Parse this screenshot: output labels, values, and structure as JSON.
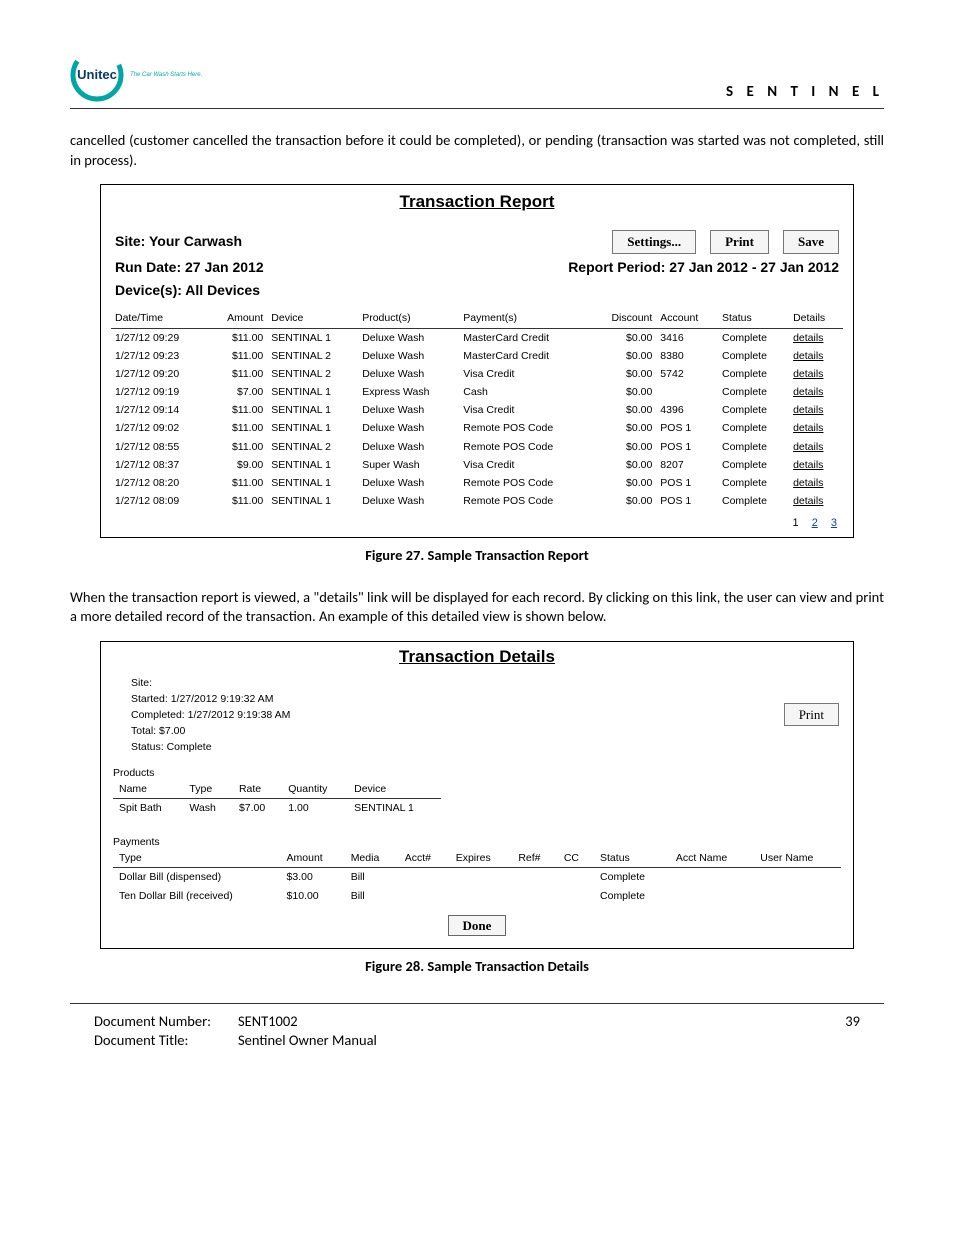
{
  "header": {
    "brand": "Unitec",
    "tagline": "The Car Wash Starts Here.",
    "product": "S E N T I N E L"
  },
  "para1": "cancelled (customer cancelled the transaction before it could be completed), or pending (transaction was started was not completed, still in process).",
  "report1": {
    "title": "Transaction Report",
    "site_label": "Site: Your Carwash",
    "btn_settings": "Settings...",
    "btn_print": "Print",
    "btn_save": "Save",
    "run_date": "Run Date: 27 Jan 2012",
    "period": "Report Period: 27 Jan 2012 - 27 Jan 2012",
    "devices": "Device(s): All Devices",
    "columns": [
      "Date/Time",
      "Amount",
      "Device",
      "Product(s)",
      "Payment(s)",
      "Discount",
      "Account",
      "Status",
      "Details"
    ],
    "details_label": "details",
    "rows": [
      {
        "dt": "1/27/12 09:29",
        "amt": "$11.00",
        "dev": "SENTINAL 1",
        "prod": "Deluxe Wash",
        "pay": "MasterCard Credit",
        "disc": "$0.00",
        "acct": "3416",
        "stat": "Complete"
      },
      {
        "dt": "1/27/12 09:23",
        "amt": "$11.00",
        "dev": "SENTINAL 2",
        "prod": "Deluxe Wash",
        "pay": "MasterCard Credit",
        "disc": "$0.00",
        "acct": "8380",
        "stat": "Complete"
      },
      {
        "dt": "1/27/12 09:20",
        "amt": "$11.00",
        "dev": "SENTINAL 2",
        "prod": "Deluxe Wash",
        "pay": "Visa Credit",
        "disc": "$0.00",
        "acct": "5742",
        "stat": "Complete"
      },
      {
        "dt": "1/27/12 09:19",
        "amt": "$7.00",
        "dev": "SENTINAL 1",
        "prod": "Express Wash",
        "pay": "Cash",
        "disc": "$0.00",
        "acct": "",
        "stat": "Complete"
      },
      {
        "dt": "1/27/12 09:14",
        "amt": "$11.00",
        "dev": "SENTINAL 1",
        "prod": "Deluxe Wash",
        "pay": "Visa Credit",
        "disc": "$0.00",
        "acct": "4396",
        "stat": "Complete"
      },
      {
        "dt": "1/27/12 09:02",
        "amt": "$11.00",
        "dev": "SENTINAL 1",
        "prod": "Deluxe Wash",
        "pay": "Remote POS Code",
        "disc": "$0.00",
        "acct": "POS 1",
        "stat": "Complete"
      },
      {
        "dt": "1/27/12 08:55",
        "amt": "$11.00",
        "dev": "SENTINAL 2",
        "prod": "Deluxe Wash",
        "pay": "Remote POS Code",
        "disc": "$0.00",
        "acct": "POS 1",
        "stat": "Complete"
      },
      {
        "dt": "1/27/12 08:37",
        "amt": "$9.00",
        "dev": "SENTINAL 1",
        "prod": "Super Wash",
        "pay": "Visa Credit",
        "disc": "$0.00",
        "acct": "8207",
        "stat": "Complete"
      },
      {
        "dt": "1/27/12 08:20",
        "amt": "$11.00",
        "dev": "SENTINAL 1",
        "prod": "Deluxe Wash",
        "pay": "Remote POS Code",
        "disc": "$0.00",
        "acct": "POS 1",
        "stat": "Complete"
      },
      {
        "dt": "1/27/12 08:09",
        "amt": "$11.00",
        "dev": "SENTINAL 1",
        "prod": "Deluxe Wash",
        "pay": "Remote POS Code",
        "disc": "$0.00",
        "acct": "POS 1",
        "stat": "Complete"
      }
    ],
    "pager": {
      "current": "1",
      "p2": "2",
      "p3": "3"
    }
  },
  "figure27": "Figure 27. Sample Transaction Report",
  "para2": "When the transaction report is viewed, a \"details\" link will be displayed for each record. By clicking on this link, the user can view and print a more detailed record of the transaction. An example of this detailed view is shown below.",
  "report2": {
    "title": "Transaction Details",
    "btn_print": "Print",
    "meta": {
      "site": "Site:",
      "started": "Started: 1/27/2012 9:19:32 AM",
      "completed": "Completed: 1/27/2012 9:19:38 AM",
      "total": "Total: $7.00",
      "status": "Status: Complete"
    },
    "products_label": "Products",
    "products_cols": [
      "Name",
      "Type",
      "Rate",
      "Quantity",
      "Device"
    ],
    "products_row": {
      "name": "Spit Bath",
      "type": "Wash",
      "rate": "$7.00",
      "qty": "1.00",
      "device": "SENTINAL 1"
    },
    "payments_label": "Payments",
    "payments_cols": [
      "Type",
      "Amount",
      "Media",
      "Acct#",
      "Expires",
      "Ref#",
      "CC",
      "Status",
      "Acct Name",
      "User Name"
    ],
    "payments_rows": [
      {
        "type": "Dollar Bill (dispensed)",
        "amount": "$3.00",
        "media": "Bill",
        "status": "Complete"
      },
      {
        "type": "Ten Dollar Bill (received)",
        "amount": "$10.00",
        "media": "Bill",
        "status": "Complete"
      }
    ],
    "done": "Done"
  },
  "figure28": "Figure 28. Sample Transaction Details",
  "footer": {
    "docnum_label": "Document Number:",
    "docnum": "SENT1002",
    "page": "39",
    "title_label": "Document Title:",
    "title": "Sentinel Owner Manual"
  }
}
